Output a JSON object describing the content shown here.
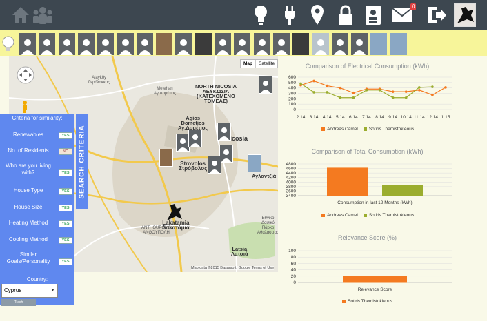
{
  "nav": {
    "icons": [
      "home-icon",
      "community-icon",
      "lightbulb-icon",
      "plug-icon",
      "map-pin-icon",
      "lock-icon",
      "contact-card-icon",
      "mail-icon",
      "logout-icon",
      "user-avatar"
    ],
    "mail_badge": "0"
  },
  "avatars": {
    "count": 20
  },
  "map": {
    "type_map": "Map",
    "type_satellite": "Satellite",
    "copyright": "Map data ©2015 Basarsoft, Google    Terms of Use",
    "labels": {
      "alaykoy": "Alayköy\nΓερόλακκος",
      "metehan": "Metehan\nΑγ.Δομέτιος",
      "north_nicosia": "NORTH NICOSIA\nΛΕΥΚΩΣΙΑ\n(ΚΑΤΕΧΟΜΕΝΟ\nΤΟΜΕΑΣ)",
      "agios_dometios": "Agios\nDometios\nΑγ.Δομέτιος",
      "nicosia": "Nicosia",
      "strovolos": "Strovolos\nΣτρόβολος",
      "aglantzia": "Αγλαντζιά",
      "lakatamia": "Lakatamia\nΛακατάμια",
      "latsia": "Latsia\nΛατσιά",
      "athalassa": "Εθνικό Δασικό\nΠάρκο Αθαλάσσας",
      "anthoupolis": "ANTHOUPOLIS\nΑΝΘΟΥΠΟΛΗ"
    }
  },
  "criteria": {
    "title": "Criteria for similarity:",
    "rows": [
      {
        "label": "Renewables",
        "state": "YES"
      },
      {
        "label": "No. of Residents",
        "state": "NO"
      },
      {
        "label": "Who are you living with?",
        "state": "YES"
      },
      {
        "label": "House Type",
        "state": "YES"
      },
      {
        "label": "House Size",
        "state": "YES"
      },
      {
        "label": "Heating Method",
        "state": "YES"
      },
      {
        "label": "Cooling Method",
        "state": "YES"
      },
      {
        "label": "Similar Goals/Personality",
        "state": "YES"
      }
    ],
    "country_label": "Country:",
    "country_value": "Cyprus",
    "trash_label": "Trash",
    "search_tab": "SEARCH CRITERIA"
  },
  "colors": {
    "series_a": "#f47a20",
    "series_b": "#9bad2e"
  },
  "chart_data": [
    {
      "type": "line",
      "title": "Comparison of Electrical Consumption (kWh)",
      "categories": [
        "2.14",
        "3.14",
        "4.14",
        "5.14",
        "6.14",
        "7.14",
        "8.14",
        "9.14",
        "10.14",
        "11.14",
        "12.14",
        "1.15"
      ],
      "ylim": [
        0,
        600
      ],
      "yticks": [
        0,
        100,
        200,
        300,
        400,
        500,
        600
      ],
      "series": [
        {
          "name": "Andreas Camel",
          "values": [
            450,
            530,
            440,
            400,
            310,
            380,
            380,
            330,
            330,
            360,
            270,
            410
          ]
        },
        {
          "name": "Sotiris Themistokleous",
          "values": [
            480,
            320,
            320,
            220,
            220,
            360,
            360,
            220,
            220,
            410,
            420,
            null
          ]
        }
      ]
    },
    {
      "type": "bar",
      "title": "Comparison of Total Consumption (kWh)",
      "categories": [
        "Consumption in last 12 Months (kWh)"
      ],
      "ylim": [
        3400,
        4800
      ],
      "yticks": [
        3400,
        3600,
        3800,
        4000,
        4200,
        4400,
        4600,
        4800
      ],
      "series": [
        {
          "name": "Andreas Camel",
          "values": [
            4620
          ]
        },
        {
          "name": "Sotiris Themistokleous",
          "values": [
            3870
          ]
        }
      ]
    },
    {
      "type": "bar",
      "title": "Relevance Score (%)",
      "categories": [
        "Relevance Score"
      ],
      "ylim": [
        0,
        100
      ],
      "yticks": [
        0,
        20,
        40,
        60,
        80,
        100
      ],
      "series": [
        {
          "name": "Sotiris Themistokleous",
          "values": [
            20
          ]
        }
      ]
    }
  ]
}
